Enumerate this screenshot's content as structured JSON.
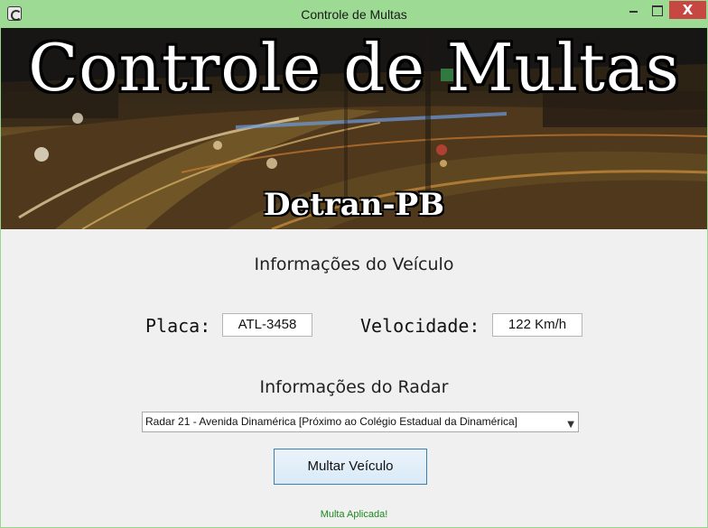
{
  "window": {
    "title": "Controle de Multas",
    "close_glyph": "X"
  },
  "banner": {
    "title": "Controle de Multas",
    "subtitle": "Detran-PB"
  },
  "vehicle": {
    "heading": "Informações do Veículo",
    "plate_label": "Placa:",
    "plate_value": "ATL-3458",
    "speed_label": "Velocidade:",
    "speed_value": "122 Km/h"
  },
  "radar": {
    "heading": "Informações do Radar",
    "selected": "Radar 21 - Avenida Dinamérica [Próximo ao Colégio Estadual da Dinamérica]"
  },
  "actions": {
    "fine_button": "Multar Veículo"
  },
  "status": {
    "message": "Multa Aplicada!",
    "color": "#1a8a1a"
  }
}
